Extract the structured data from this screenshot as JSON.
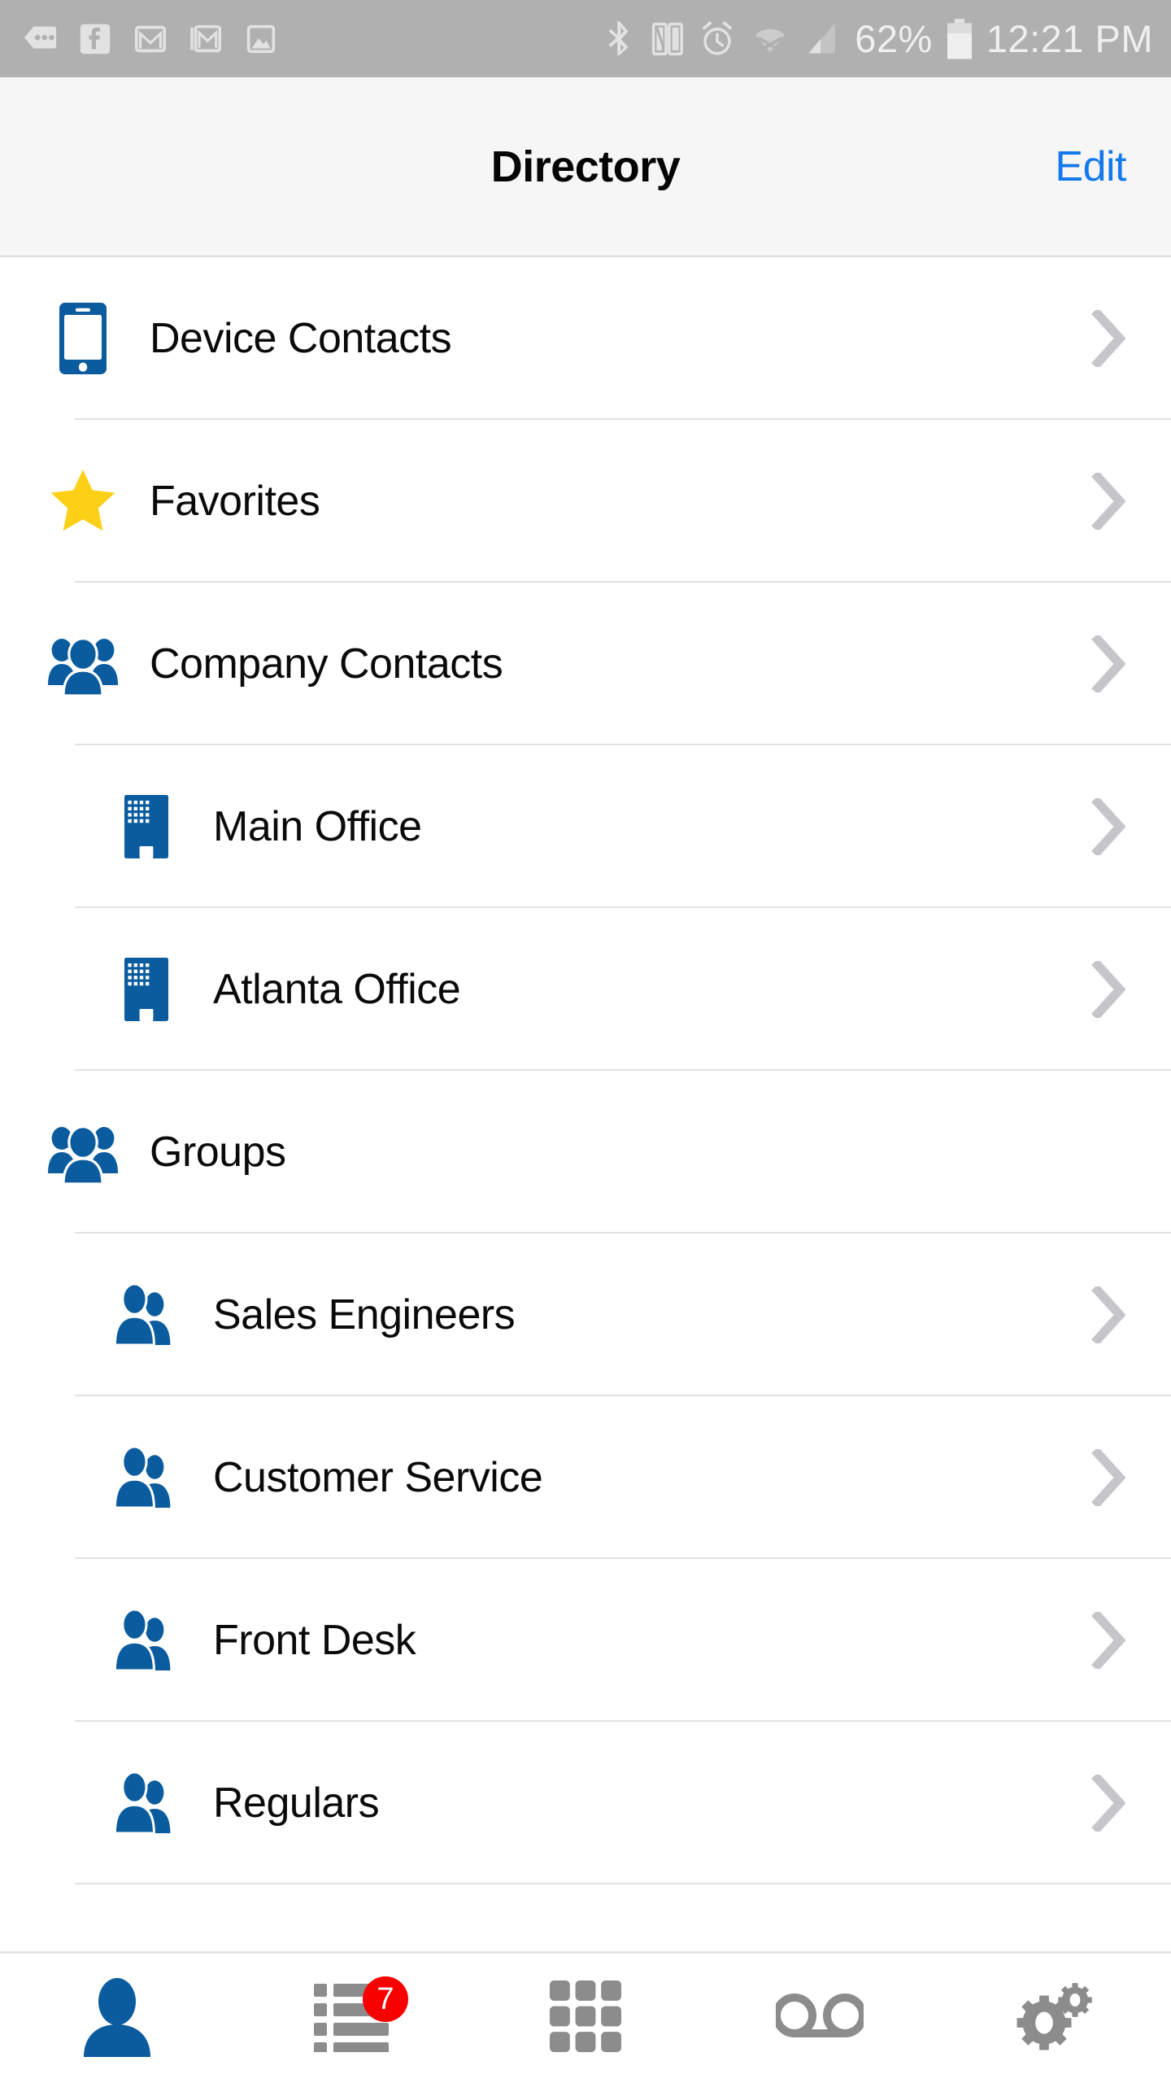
{
  "statusbar": {
    "left_icons": [
      {
        "name": "messages-icon",
        "label": "messages"
      },
      {
        "name": "facebook-icon",
        "label": "facebook"
      },
      {
        "name": "gmail-icon",
        "label": "gmail"
      },
      {
        "name": "gmail-secondary-icon",
        "label": "gmail"
      },
      {
        "name": "photos-icon",
        "label": "photos"
      }
    ],
    "right_icons": [
      {
        "name": "bluetooth-icon",
        "label": "bluetooth"
      },
      {
        "name": "nfc-icon",
        "label": "nfc"
      },
      {
        "name": "alarm-icon",
        "label": "alarm"
      },
      {
        "name": "wifi-disconnected-icon",
        "label": "wifi"
      },
      {
        "name": "cell-signal-icon",
        "label": "signal"
      }
    ],
    "battery_percent": "62%",
    "time": "12:21 PM"
  },
  "header": {
    "title": "Directory",
    "edit_label": "Edit"
  },
  "list": {
    "items": [
      {
        "label": "Device Contacts",
        "icon": "smartphone-icon",
        "level": 1,
        "chevron": true
      },
      {
        "label": "Favorites",
        "icon": "star-icon",
        "level": 1,
        "chevron": true
      },
      {
        "label": "Company Contacts",
        "icon": "group-three-icon",
        "level": 1,
        "chevron": true
      },
      {
        "label": "Main Office",
        "icon": "office-building-icon",
        "level": 2,
        "chevron": true
      },
      {
        "label": "Atlanta Office",
        "icon": "office-building-icon",
        "level": 2,
        "chevron": true
      },
      {
        "label": "Groups",
        "icon": "group-three-icon",
        "level": 1,
        "chevron": false
      },
      {
        "label": "Sales Engineers",
        "icon": "group-two-icon",
        "level": 2,
        "chevron": true
      },
      {
        "label": "Customer Service",
        "icon": "group-two-icon",
        "level": 2,
        "chevron": true
      },
      {
        "label": "Front Desk",
        "icon": "group-two-icon",
        "level": 2,
        "chevron": true
      },
      {
        "label": "Regulars",
        "icon": "group-two-icon",
        "level": 2,
        "chevron": true
      }
    ]
  },
  "tabbar": {
    "tabs": [
      {
        "name": "contacts",
        "icon": "person-icon",
        "active": true,
        "badge": null
      },
      {
        "name": "history",
        "icon": "list-icon",
        "active": false,
        "badge": "7"
      },
      {
        "name": "keypad",
        "icon": "keypad-icon",
        "active": false,
        "badge": null
      },
      {
        "name": "voicemail",
        "icon": "voicemail-icon",
        "active": false,
        "badge": null
      },
      {
        "name": "settings",
        "icon": "settings-gears-icon",
        "active": false,
        "badge": null
      }
    ]
  },
  "colors": {
    "accent_blue": "#0b5c9e",
    "link_blue": "#1379ec",
    "star_yellow": "#fbd017",
    "badge_red": "#f90000",
    "tab_inactive": "#8c8c8c",
    "chevron_gray": "#c5c6c9",
    "statusbar_gray": "#b0b0b0",
    "header_bg": "#f6f6f6"
  }
}
